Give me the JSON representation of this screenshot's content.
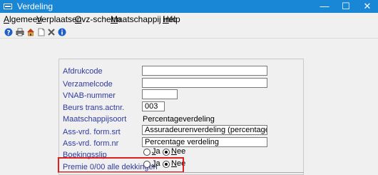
{
  "window": {
    "title": "Verdeling",
    "min": "—",
    "max": "☐",
    "close": "✕"
  },
  "menu": [
    {
      "first": "A",
      "rest": "lgemeen"
    },
    {
      "first": "V",
      "rest": "erplaatsen"
    },
    {
      "first": "O",
      "rest": "vz-scherm"
    },
    {
      "first": "M",
      "rest": "aatschappij info"
    },
    {
      "first": "H",
      "rest": "elp"
    }
  ],
  "toolbar": [
    "help-icon",
    "print-icon",
    "home-icon",
    "new-document-icon",
    "delete-icon",
    "info-icon"
  ],
  "form": {
    "afdrukcode": {
      "label": "Afdrukcode",
      "value": ""
    },
    "verzamelcode": {
      "label": "Verzamelcode",
      "value": ""
    },
    "vnab": {
      "label": "VNAB-nummer",
      "value": ""
    },
    "beurs": {
      "label": "Beurs trans.actnr.",
      "value": "003"
    },
    "maatschappijsoort": {
      "label": "Maatschappijsoort",
      "value": "Percentageverdeling"
    },
    "ass_srt": {
      "label": "Ass-vrd. form.srt",
      "value": "Assuradeurenverdeling (percentage)"
    },
    "ass_nr": {
      "label": "Ass-vrd. form.nr",
      "value": "Percentage verdeling"
    },
    "boekingsslip": {
      "label": "Boekingsslip",
      "ja_first": "J",
      "ja_rest": "a",
      "nee_first": "N",
      "nee_rest": "ee",
      "selected": "Nee"
    },
    "premie": {
      "label": "Premie 0/00 alle dekkingen",
      "ja_first": "J",
      "ja_rest": "a",
      "nee_first": "N",
      "nee_rest": "ee",
      "selected": "Nee"
    }
  },
  "colors": {
    "titlebar": "#1a86d6",
    "label": "#2f3a9e",
    "highlight": "#e02020"
  }
}
